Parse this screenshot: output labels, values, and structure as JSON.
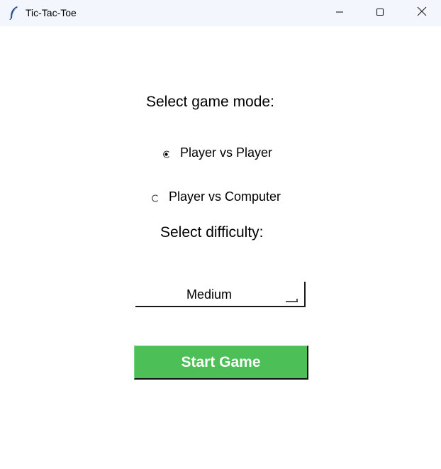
{
  "window": {
    "title": "Tic-Tac-Toe",
    "app_icon": "feather-icon",
    "controls": [
      "minimize-icon",
      "maximize-icon",
      "close-icon"
    ]
  },
  "game_mode": {
    "heading": "Select game mode:",
    "options": [
      {
        "label": "Player vs Player",
        "selected": true
      },
      {
        "label": "Player vs Computer",
        "selected": false
      }
    ]
  },
  "difficulty": {
    "heading": "Select difficulty:",
    "selected_value": "Medium"
  },
  "start_button": {
    "label": "Start Game",
    "color": "#4cbf56",
    "text_color": "#ffffff"
  },
  "colors": {
    "titlebar_bg": "#f3f6fc",
    "window_bg": "#ffffff"
  }
}
